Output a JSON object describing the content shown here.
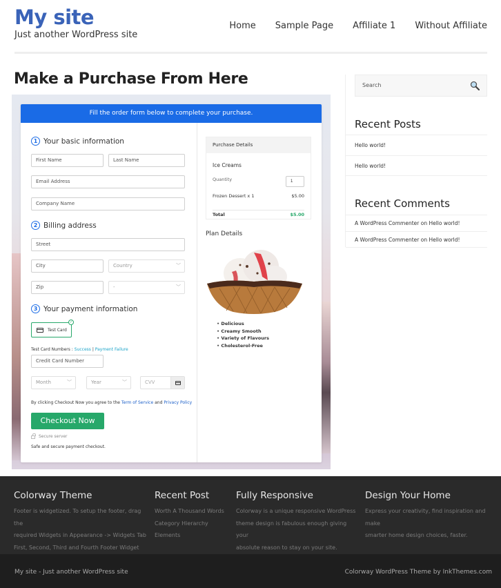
{
  "header": {
    "site_title": "My site",
    "tagline": "Just another WordPress site",
    "nav": [
      "Home",
      "Sample Page",
      "Affiliate 1",
      "Without Affiliate"
    ]
  },
  "page": {
    "title": "Make a Purchase From Here"
  },
  "form": {
    "banner": "Fill the order form below to complete your purchase.",
    "section1": {
      "num": "1",
      "title": "Your basic information"
    },
    "first_name": "First Name",
    "last_name": "Last Name",
    "email": "Email Address",
    "company": "Company Name",
    "section2": {
      "num": "2",
      "title": "Billing address"
    },
    "street": "Street",
    "city": "City",
    "country": "Country",
    "zip": "Zip",
    "state": "-",
    "section3": {
      "num": "3",
      "title": "Your payment information"
    },
    "test_card_label": "Test Card",
    "test_card_numbers_label": "Test Card Numbers :",
    "success_link": "Success",
    "separator": "|",
    "failure_link": "Payment Failure",
    "credit_card": "Credit Card Number",
    "month": "Month",
    "year": "Year",
    "cvv": "CVV",
    "agree_prefix": "By clicking Checkout Now you agree to the",
    "terms_link": "Term of Service",
    "and": "and",
    "privacy_link": "Privacy Policy",
    "checkout_button": "Checkout Now",
    "secure_server": "Secure server",
    "safe_text": "Safe and secure payment checkout."
  },
  "purchase": {
    "header": "Purchase Details",
    "product": "Ice Creams",
    "quantity_label": "Quantity",
    "quantity_value": "1",
    "line_item": "Frozen Dessert x 1",
    "line_price": "$5.00",
    "total_label": "Total",
    "total_value": "$5.00",
    "plan_title": "Plan Details",
    "features": [
      "Delicious",
      "Creamy Smooth",
      "Variety of Flavours",
      "Cholesterol-Free"
    ]
  },
  "sidebar": {
    "search_placeholder": "Search",
    "recent_posts_title": "Recent Posts",
    "recent_posts": [
      "Hello world!",
      "Hello world!"
    ],
    "recent_comments_title": "Recent Comments",
    "recent_comments": [
      "A WordPress Commenter on Hello world!",
      "A WordPress Commenter on Hello world!"
    ]
  },
  "footer": {
    "columns": [
      {
        "title": "Colorway Theme",
        "lines": [
          "Footer is widgetized. To setup the footer, drag the",
          "required Widgets in Appearance -> Widgets Tab",
          "First, Second, Third and Fourth Footer Widget"
        ]
      },
      {
        "title": "Recent Post",
        "lines": [
          "Worth A Thousand Words",
          "Category Hierarchy",
          "Elements"
        ]
      },
      {
        "title": "Fully Responsive",
        "lines": [
          "Colorway is a unique responsive WordPress",
          "theme design is fabulous enough giving your",
          "absolute reason to stay on your site."
        ]
      },
      {
        "title": "Design Your Home",
        "lines": [
          "Express your creativity, find inspiration and make",
          "smarter home design choices, faster."
        ]
      }
    ],
    "bottom_left": "My site - Just another WordPress site",
    "bottom_right": "Colorway WordPress Theme by InkThemes.com"
  },
  "colors": {
    "brand_blue": "#3a63b8",
    "form_blue": "#1a6be6",
    "checkout_green": "#27a86a",
    "footer_bg": "#2a2a2a"
  }
}
